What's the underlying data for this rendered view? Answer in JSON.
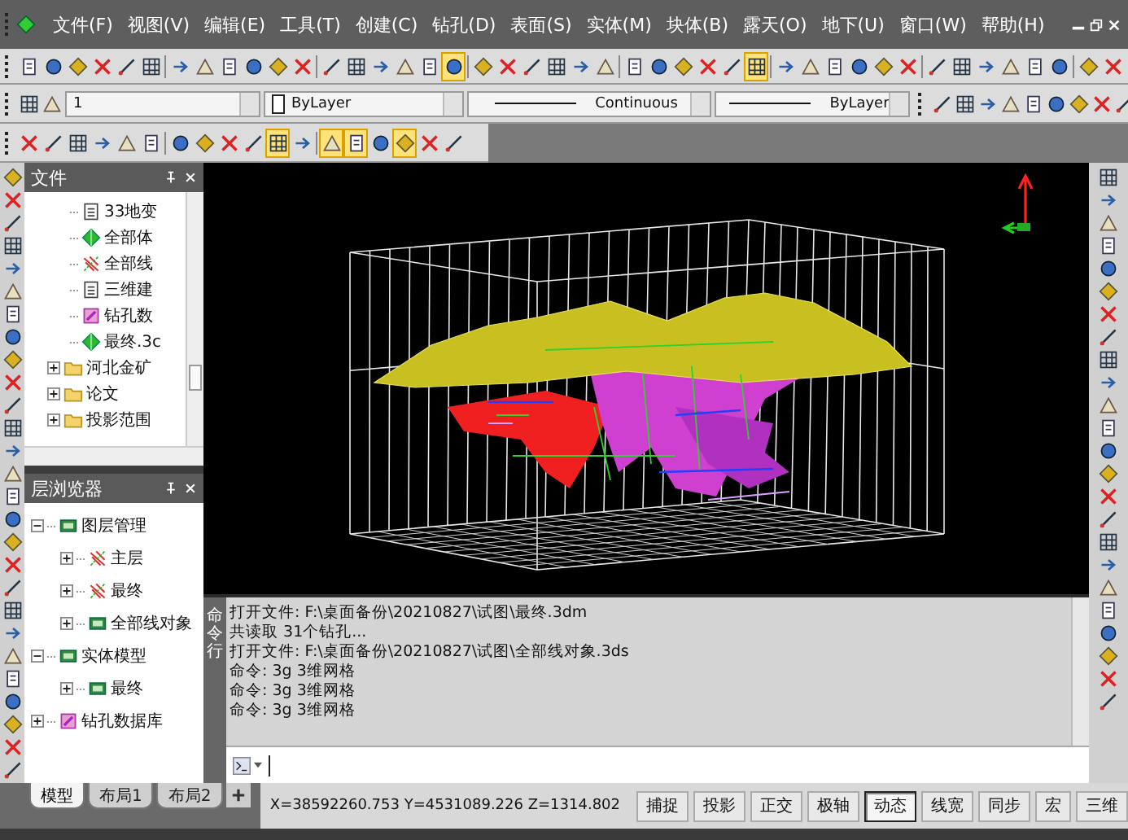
{
  "menu": [
    "文件(F)",
    "视图(V)",
    "编辑(E)",
    "工具(T)",
    "创建(C)",
    "钻孔(D)",
    "表面(S)",
    "实体(M)",
    "块体(B)",
    "露天(O)",
    "地下(U)",
    "窗口(W)",
    "帮助(H)"
  ],
  "toolbars": [
    {
      "buttons": [
        {
          "selected": false
        },
        {
          "selected": false
        },
        {
          "selected": false
        },
        {
          "selected": false
        },
        {
          "selected": false
        },
        {
          "selected": false
        },
        {
          "selected": false
        },
        {
          "selected": false
        },
        {
          "selected": false
        },
        {
          "selected": false
        },
        {
          "selected": false
        },
        {
          "selected": false
        },
        {
          "selected": false
        },
        {
          "selected": false
        },
        {
          "selected": false
        },
        {
          "selected": false
        },
        {
          "selected": false
        },
        {
          "selected": true
        },
        {
          "selected": false
        },
        {
          "selected": false
        },
        {
          "selected": false
        },
        {
          "selected": false
        },
        {
          "selected": false
        },
        {
          "selected": false
        },
        {
          "selected": false
        },
        {
          "selected": false
        },
        {
          "selected": false
        },
        {
          "selected": false
        },
        {
          "selected": false
        },
        {
          "selected": true
        },
        {
          "selected": false
        },
        {
          "selected": false
        },
        {
          "selected": false
        },
        {
          "selected": false
        },
        {
          "selected": false
        },
        {
          "selected": false
        },
        {
          "selected": false
        },
        {
          "selected": false
        },
        {
          "selected": false
        },
        {
          "selected": false
        },
        {
          "selected": false
        },
        {
          "selected": false
        },
        {
          "selected": false
        },
        {
          "selected": false
        }
      ]
    },
    {
      "buttons": [
        {
          "selected": false
        },
        {
          "selected": false
        },
        {
          "selected": false
        },
        {
          "selected": false
        },
        {
          "selected": false
        },
        {
          "selected": false
        },
        {
          "selected": false
        },
        {
          "selected": false
        },
        {
          "selected": false
        },
        {
          "selected": false
        },
        {
          "selected": true
        },
        {
          "selected": false
        },
        {
          "selected": true
        },
        {
          "selected": true
        },
        {
          "selected": false
        },
        {
          "selected": true
        },
        {
          "selected": false
        },
        {
          "selected": false
        }
      ]
    }
  ],
  "properties": {
    "layer": "1",
    "pen": "ByLayer",
    "linetype": "Continuous",
    "lineweight": "ByLayer"
  },
  "file_panel": {
    "title": "文件",
    "items": [
      {
        "label": "33地变",
        "kind": "doc"
      },
      {
        "label": "全部体",
        "kind": "model"
      },
      {
        "label": "全部线",
        "kind": "lines"
      },
      {
        "label": "三维建",
        "kind": "doc"
      },
      {
        "label": "钻孔数",
        "kind": "database"
      },
      {
        "label": "最终.3c",
        "kind": "model"
      },
      {
        "label": "河北金矿",
        "kind": "folder",
        "expanded": false
      },
      {
        "label": "论文",
        "kind": "folder",
        "expanded": false
      },
      {
        "label": "投影范围",
        "kind": "folder",
        "expanded": false
      }
    ]
  },
  "layer_panel": {
    "title": "层浏览器",
    "items": [
      {
        "label": "图层管理",
        "kind": "layers",
        "expanded": true,
        "children": [
          {
            "label": "主层",
            "kind": "lines",
            "expanded": false
          },
          {
            "label": "最终",
            "kind": "lines",
            "expanded": false
          },
          {
            "label": "全部线对象",
            "kind": "layers",
            "expanded": false
          }
        ]
      },
      {
        "label": "实体模型",
        "kind": "layers",
        "expanded": true,
        "children": [
          {
            "label": "最终",
            "kind": "layers",
            "expanded": false
          }
        ]
      },
      {
        "label": "钻孔数据库",
        "kind": "database",
        "expanded": false
      }
    ]
  },
  "command": {
    "title": "命令行",
    "history": [
      "打开文件: F:\\桌面备份\\20210827\\试图\\最终.3dm",
      "共读取 31个钻孔...",
      "打开文件: F:\\桌面备份\\20210827\\试图\\全部线对象.3ds",
      "命令: 3g  3维网格",
      "命令: 3g  3维网格",
      "命令: 3g  3维网格"
    ]
  },
  "layout_tabs": [
    {
      "label": "模型",
      "selected": true
    },
    {
      "label": "布局1",
      "selected": false
    },
    {
      "label": "布局2",
      "selected": false
    }
  ],
  "status_bar": {
    "coordinates": "X=38592260.753 Y=4531089.226 Z=1314.802",
    "toggles": [
      {
        "label": "捕捉",
        "on": false
      },
      {
        "label": "投影",
        "on": false
      },
      {
        "label": "正交",
        "on": false
      },
      {
        "label": "极轴",
        "on": false
      },
      {
        "label": "动态",
        "on": true
      },
      {
        "label": "线宽",
        "on": false
      },
      {
        "label": "同步",
        "on": false
      },
      {
        "label": "宏",
        "on": false
      },
      {
        "label": "三维",
        "on": false
      }
    ]
  }
}
